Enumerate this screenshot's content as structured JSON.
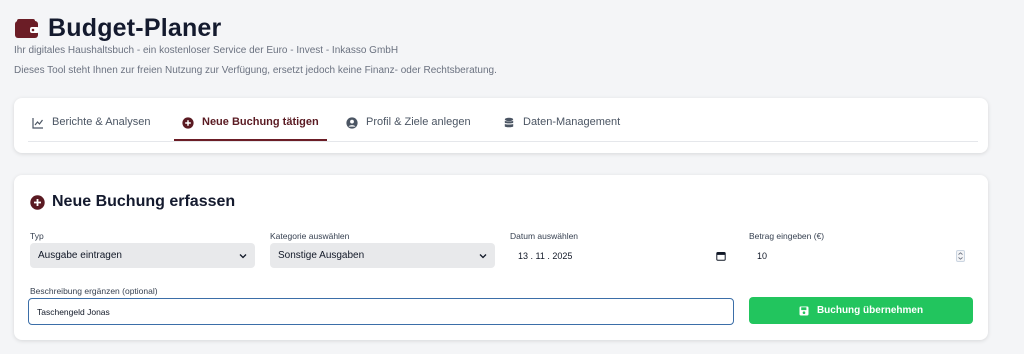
{
  "app": {
    "title": "Budget-Planer",
    "subtitle": "Ihr digitales Haushaltsbuch - ein kostenloser Service der Euro - Invest - Inkasso GmbH",
    "disclaimer": "Dieses Tool steht Ihnen zur freien Nutzung zur Verfügung, ersetzt jedoch keine Finanz- oder Rechtsberatung.",
    "brand_color": "#6b1d26"
  },
  "tabs": [
    {
      "label": "Berichte & Analysen",
      "icon": "chart-line-icon",
      "active": false
    },
    {
      "label": "Neue Buchung tätigen",
      "icon": "plus-circle-icon",
      "active": true
    },
    {
      "label": "Profil & Ziele anlegen",
      "icon": "user-circle-icon",
      "active": false
    },
    {
      "label": "Daten-Management",
      "icon": "database-icon",
      "active": false
    }
  ],
  "form": {
    "title": "Neue Buchung erfassen",
    "type": {
      "label": "Typ",
      "value": "Ausgabe eintragen"
    },
    "category": {
      "label": "Kategorie auswählen",
      "value": "Sonstige Ausgaben"
    },
    "date": {
      "label": "Datum auswählen",
      "value": "13 . 11 . 2025"
    },
    "amount": {
      "label": "Betrag eingeben (€)",
      "value": "10"
    },
    "description": {
      "label": "Beschreibung ergänzen (optional)",
      "value": "Taschengeld Jonas"
    },
    "submit_label": "Buchung übernehmen",
    "submit_color": "#22c55e"
  }
}
